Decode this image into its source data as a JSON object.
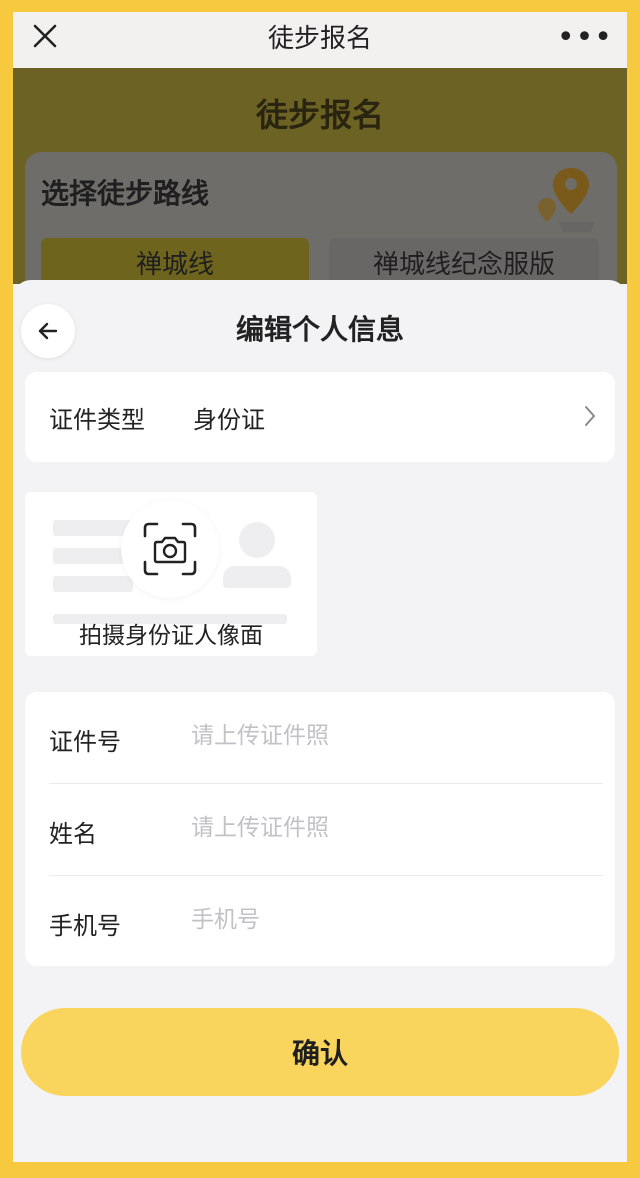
{
  "topbar": {
    "title": "徒步报名",
    "more": "•••"
  },
  "background_page": {
    "title": "徒步报名",
    "heading": "选择徒步路线",
    "tabs": [
      "禅城线",
      "禅城线纪念服版"
    ]
  },
  "sheet": {
    "title": "编辑个人信息",
    "id_type": {
      "label": "证件类型",
      "value": "身份证"
    },
    "photo": {
      "label": "拍摄身份证人像面"
    },
    "fields": [
      {
        "label": "证件号",
        "placeholder": "请上传证件照",
        "value": ""
      },
      {
        "label": "姓名",
        "placeholder": "请上传证件照",
        "value": ""
      },
      {
        "label": "手机号",
        "placeholder": "手机号",
        "value": ""
      }
    ],
    "confirm_label": "确认"
  },
  "colors": {
    "accent": "#F9D55D",
    "frame": "#F6C93E",
    "placeholder": "#C2C2C6"
  },
  "icons": [
    "close-icon",
    "more-icon",
    "location-pin-icon",
    "back-arrow-icon",
    "chevron-right-icon",
    "camera-icon"
  ]
}
